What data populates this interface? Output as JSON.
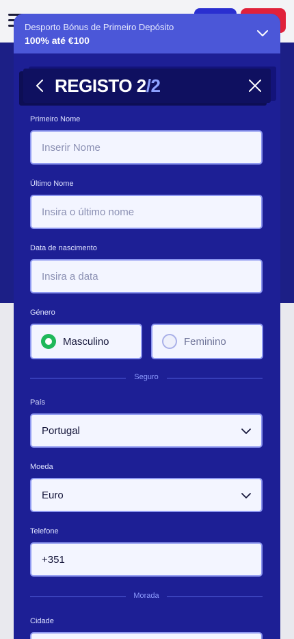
{
  "bonus": {
    "title": "Desporto Bónus de Primeiro Depósito",
    "value": "100% até €100"
  },
  "header": {
    "title": "REGISTO 2",
    "step": "/2"
  },
  "form": {
    "first_name": {
      "label": "Primeiro Nome",
      "placeholder": "Inserir Nome"
    },
    "last_name": {
      "label": "Último Nome",
      "placeholder": "Insira o último nome"
    },
    "birth_date": {
      "label": "Data de nascimento",
      "placeholder": "Insira a data"
    },
    "gender": {
      "label": "Género",
      "options": [
        "Masculino",
        "Feminino"
      ],
      "selected": "Masculino"
    },
    "section_secure": "Seguro",
    "country": {
      "label": "País",
      "value": "Portugal"
    },
    "currency": {
      "label": "Moeda",
      "value": "Euro"
    },
    "phone": {
      "label": "Telefone",
      "value": "+351"
    },
    "section_address": "Morada",
    "city": {
      "label": "Cidade"
    }
  },
  "colors": {
    "modal_bg": "#1d1f95",
    "bonus_bar": "#4b57d8",
    "radio_selected": "#1fb85a"
  }
}
